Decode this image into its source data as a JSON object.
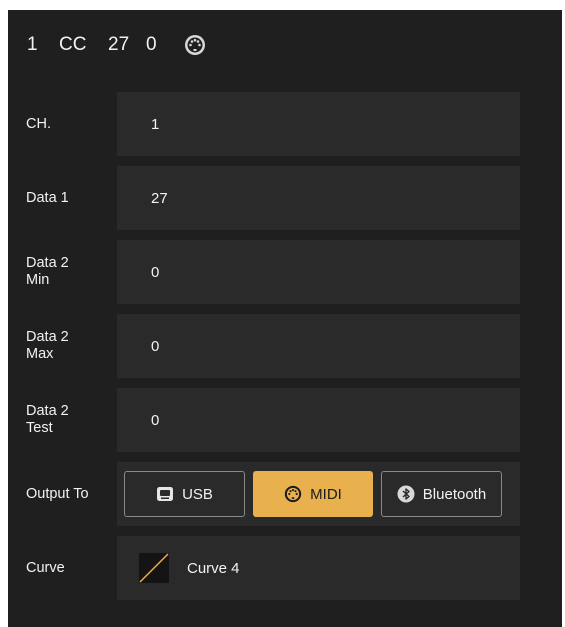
{
  "header": {
    "channel": "1",
    "type": "CC",
    "data1": "27",
    "data2": "0",
    "icon": "midi-din-icon"
  },
  "rows": {
    "channel": {
      "label": "CH.",
      "value": "1"
    },
    "data1": {
      "label": "Data 1",
      "value": "27"
    },
    "data2_min": {
      "label": "Data 2\nMin",
      "value": "0"
    },
    "data2_max": {
      "label": "Data 2\nMax",
      "value": "0"
    },
    "data2_test": {
      "label": "Data 2\nTest",
      "value": "0"
    },
    "output": {
      "label": "Output To",
      "options": {
        "usb": {
          "label": "USB",
          "icon": "usb-icon",
          "selected": false
        },
        "midi": {
          "label": "MIDI",
          "icon": "midi-din-icon",
          "selected": true
        },
        "bluetooth": {
          "label": "Bluetooth",
          "icon": "bluetooth-icon",
          "selected": false
        }
      }
    },
    "curve": {
      "label": "Curve",
      "value": "Curve 4",
      "icon": "curve-icon"
    }
  },
  "colors": {
    "panel_bg": "#1f1f1f",
    "field_bg": "#2a2a2a",
    "accent": "#e9b04e",
    "text": "#f2f2f2"
  }
}
